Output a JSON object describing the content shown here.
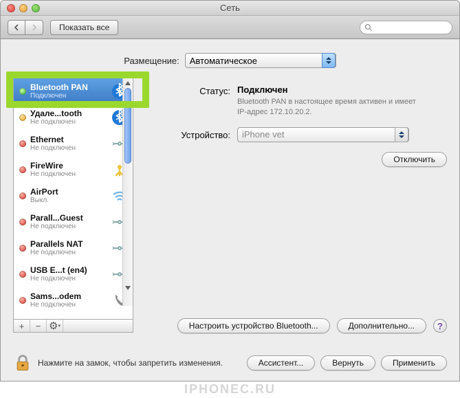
{
  "window": {
    "title": "Сеть"
  },
  "toolbar": {
    "show_all": "Показать все"
  },
  "location": {
    "label": "Размещение:",
    "value": "Автоматическое"
  },
  "sidebar": {
    "items": [
      {
        "name": "Bluetooth PAN",
        "status": "Подключен",
        "dot": "green-dot",
        "icon": "bluetooth",
        "selected": true
      },
      {
        "name": "Удале...tooth",
        "status": "Не подключен",
        "dot": "amber-dot",
        "icon": "bluetooth"
      },
      {
        "name": "Ethernet",
        "status": "Не подключен",
        "dot": "red-dot",
        "icon": "ethernet"
      },
      {
        "name": "FireWire",
        "status": "Не подключен",
        "dot": "red-dot",
        "icon": "firewire"
      },
      {
        "name": "AirPort",
        "status": "Выкл.",
        "dot": "red-dot",
        "icon": "wifi"
      },
      {
        "name": "Parall...Guest",
        "status": "Не подключен",
        "dot": "red-dot",
        "icon": "ethernet"
      },
      {
        "name": "Parallels NAT",
        "status": "Не подключен",
        "dot": "red-dot",
        "icon": "ethernet"
      },
      {
        "name": "USB E...t (en4)",
        "status": "Не подключен",
        "dot": "red-dot",
        "icon": "ethernet"
      },
      {
        "name": "Sams...odem",
        "status": "Не подключен",
        "dot": "red-dot",
        "icon": "phone"
      }
    ]
  },
  "details": {
    "status_label": "Статус:",
    "status_value": "Подключен",
    "status_desc": "Bluetooth PAN в настоящее время активен и имеет IP-адрес 172.10.20.2.",
    "device_label": "Устройство:",
    "device_value": "iPhone vet",
    "disconnect": "Отключить",
    "configure": "Настроить устройство Bluetooth...",
    "advanced": "Дополнительно..."
  },
  "footer": {
    "lock_text": "Нажмите на замок, чтобы запретить изменения.",
    "assistant": "Ассистент...",
    "revert": "Вернуть",
    "apply": "Применить"
  },
  "watermark": "IPHONEC.RU"
}
